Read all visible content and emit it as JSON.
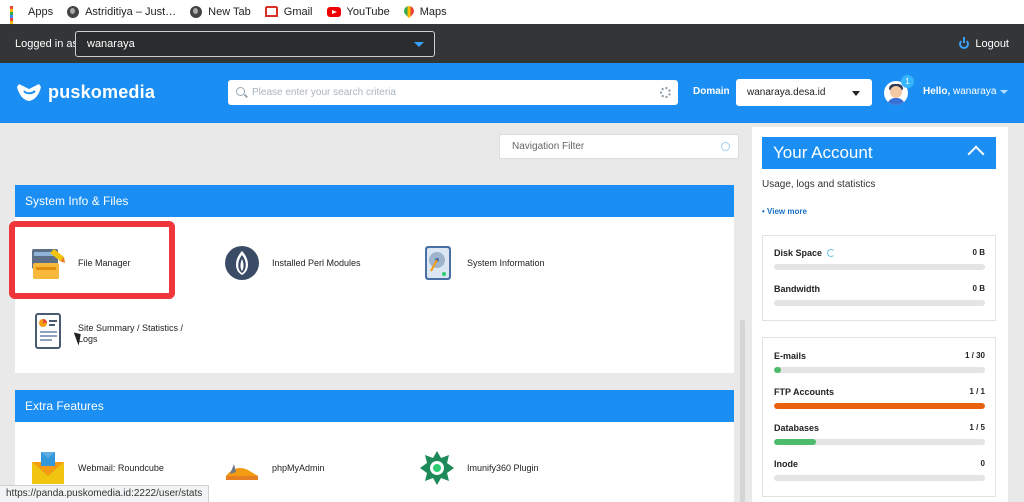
{
  "bookmarks": [
    {
      "label": "Apps",
      "icon": "apps-grid-icon"
    },
    {
      "label": "Astriditiya – Just…",
      "icon": "globe-icon"
    },
    {
      "label": "New Tab",
      "icon": "globe-icon"
    },
    {
      "label": "Gmail",
      "icon": "gmail-icon"
    },
    {
      "label": "YouTube",
      "icon": "youtube-icon"
    },
    {
      "label": "Maps",
      "icon": "maps-icon"
    }
  ],
  "topbar": {
    "logged_in_label": "Logged in as",
    "user": "wanaraya",
    "logout": "Logout"
  },
  "header": {
    "brand": "puskomedia",
    "search_placeholder": "Please enter your search criteria",
    "domain_label": "Domain",
    "domain_value": "wanaraya.desa.id",
    "notification_count": "1",
    "hello_prefix": "Hello,",
    "hello_user": "wanaraya"
  },
  "main": {
    "nav_filter_placeholder": "Navigation Filter",
    "sections": [
      {
        "title": "System Info & Files",
        "items": [
          {
            "label": "File Manager",
            "icon": "file-manager-icon"
          },
          {
            "label": "Installed Perl Modules",
            "icon": "perl-onion-icon"
          },
          {
            "label": "System Information",
            "icon": "hard-disk-icon"
          },
          {
            "label": "Site Summary / Statistics / Logs",
            "icon": "statistics-report-icon"
          }
        ]
      },
      {
        "title": "Extra Features",
        "items": [
          {
            "label": "Webmail: Roundcube",
            "icon": "webmail-envelope-icon"
          },
          {
            "label": "phpMyAdmin",
            "icon": "phpmyadmin-icon"
          },
          {
            "label": "Imunify360 Plugin",
            "icon": "imunify-shield-icon"
          }
        ]
      }
    ]
  },
  "account": {
    "title": "Your Account",
    "subtitle": "Usage, logs and statistics",
    "view_more": "• View more",
    "stats_group1": [
      {
        "label": "Disk Space",
        "value": "0 B",
        "fraction": 0
      },
      {
        "label": "Bandwidth",
        "value": "0 B",
        "fraction": 0
      }
    ],
    "stats_group2": [
      {
        "label": "E-mails",
        "value": "1 / 30",
        "fraction": 0.033,
        "color": "#4cbb6c"
      },
      {
        "label": "FTP Accounts",
        "value": "1 / 1",
        "fraction": 1,
        "color": "#e8610f"
      },
      {
        "label": "Databases",
        "value": "1 / 5",
        "fraction": 0.2,
        "color": "#4cbb6c"
      },
      {
        "label": "Inode",
        "value": "0",
        "fraction": 0,
        "color": "#4cbb6c"
      }
    ]
  },
  "status_url": "https://panda.puskomedia.id:2222/user/stats"
}
